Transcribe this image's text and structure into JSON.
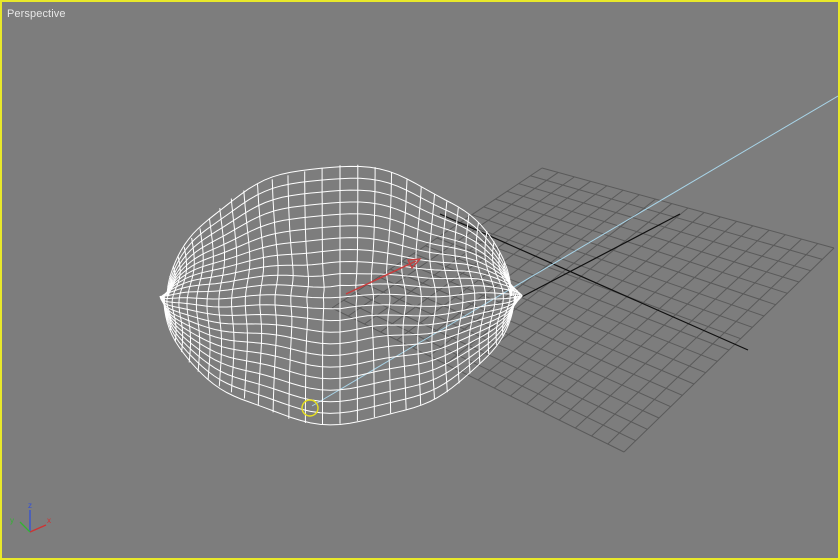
{
  "viewport": {
    "label": "Perspective",
    "border_color": "#e8e82a",
    "background": "#7d7d7d"
  },
  "gizmo": {
    "x_label": "x",
    "y_label": "y",
    "z_label": "z",
    "x_color": "#d03232",
    "y_color": "#32b432",
    "z_color": "#3250d8"
  },
  "scene": {
    "wireframe_color": "#ffffff",
    "grid_color": "#5a5a5a",
    "grid_axis_color": "#111111",
    "camera_line_color": "#a8d4e8",
    "direction_arrow_color": "#c83c3c",
    "pivot_marker_color": "#e8e020"
  }
}
